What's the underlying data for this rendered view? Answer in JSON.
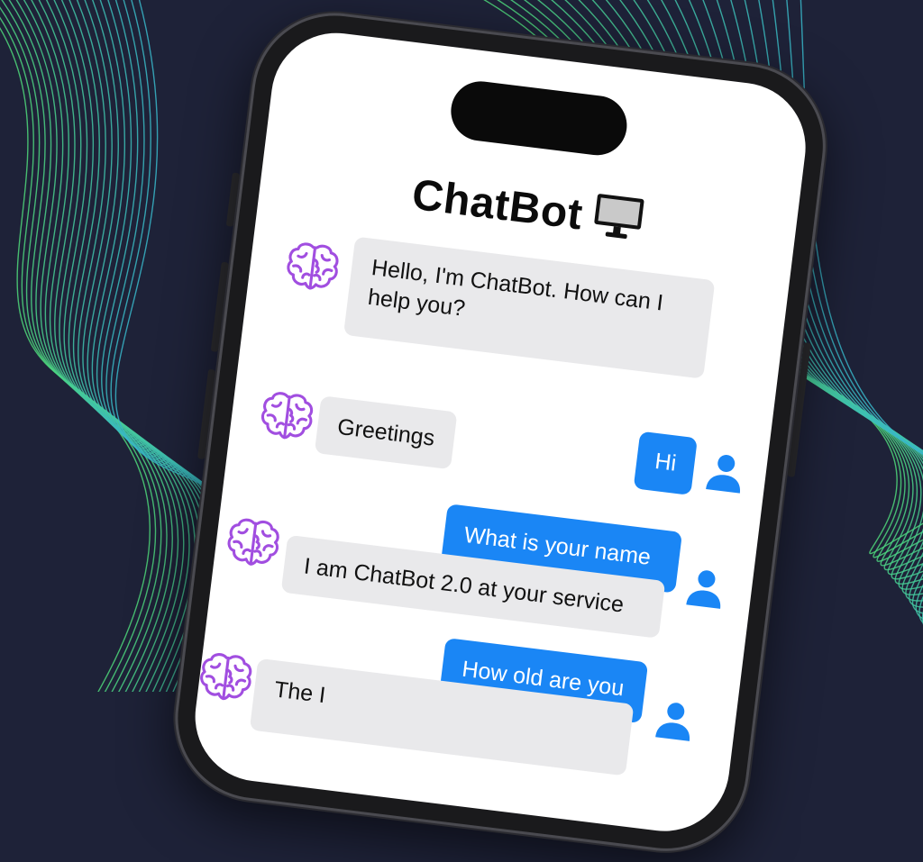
{
  "app": {
    "title": "ChatBot",
    "title_icon": "desktop-monitor-icon"
  },
  "colors": {
    "background": "#1e2238",
    "line_green": "#4fd87a",
    "line_teal": "#38b6c9",
    "bot_bubble": "#e9e9eb",
    "user_bubble": "#1a86f5",
    "bot_avatar": "#a14ee0",
    "user_avatar": "#1a86f5"
  },
  "messages": [
    {
      "sender": "bot",
      "text": "Hello, I'm ChatBot.  How can I help you?",
      "avatar_icon": "brain-icon"
    },
    {
      "sender": "user",
      "text": "Hi",
      "avatar_icon": "user-icon"
    },
    {
      "sender": "bot",
      "text": "Greetings",
      "avatar_icon": "brain-icon"
    },
    {
      "sender": "user",
      "text": "What is your name",
      "avatar_icon": "user-icon"
    },
    {
      "sender": "bot",
      "text": "I am ChatBot 2.0 at your service",
      "avatar_icon": "brain-icon"
    },
    {
      "sender": "user",
      "text": "How old are you",
      "avatar_icon": "user-icon"
    },
    {
      "sender": "bot",
      "text": "The I",
      "avatar_icon": "brain-icon"
    }
  ]
}
